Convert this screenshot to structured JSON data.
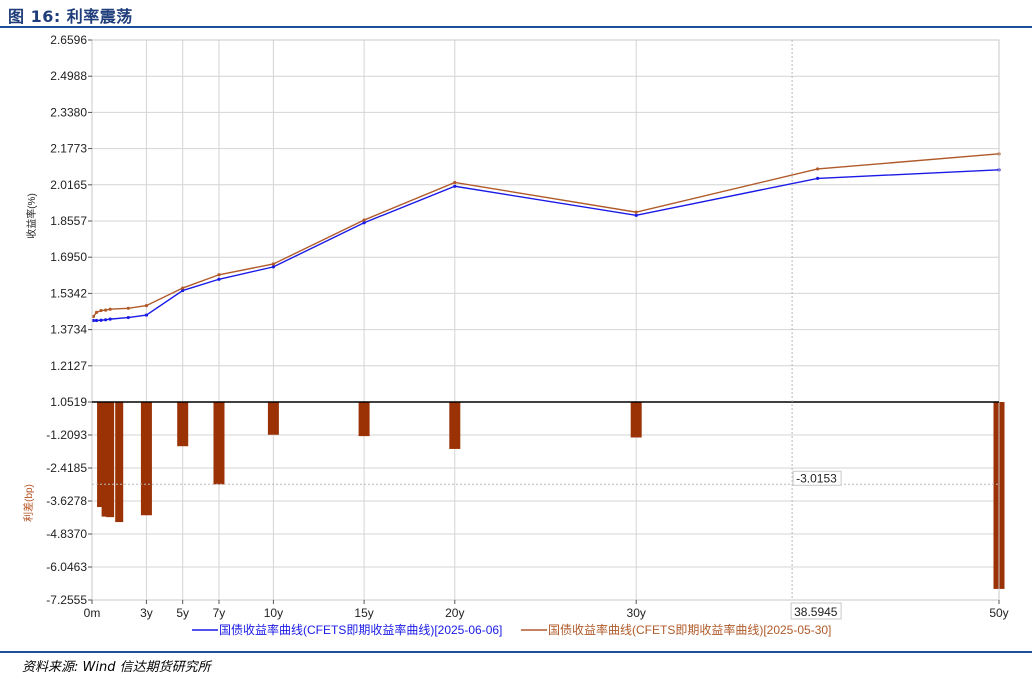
{
  "figure_title": "图 16:  利率震荡",
  "source_note": "资料来源:    Wind  信达期货研究所",
  "chart_data": [
    {
      "type": "line",
      "ylabel": "收益率(%)",
      "y_ticks": [
        "2.6596",
        "2.4988",
        "2.3380",
        "2.1773",
        "2.0165",
        "1.8557",
        "1.6950",
        "1.5342",
        "1.3734",
        "1.2127",
        "1.0519"
      ],
      "ylim": [
        1.0519,
        2.6596
      ],
      "x": [
        0.08,
        0.25,
        0.5,
        0.75,
        1,
        2,
        3,
        5,
        7,
        10,
        15,
        20,
        30,
        40,
        50
      ],
      "series": [
        {
          "name": "国债收益率曲线(CFETS即期收益率曲线)[2025-06-06]",
          "color": "#1a1ae6",
          "values": [
            1.414,
            1.414,
            1.415,
            1.417,
            1.42,
            1.427,
            1.438,
            1.547,
            1.597,
            1.652,
            1.848,
            2.01,
            1.881,
            2.045,
            2.083
          ]
        },
        {
          "name": "国债收益率曲线(CFETS即期收益率曲线)[2025-05-30]",
          "color": "#b05a2a",
          "values": [
            1.432,
            1.45,
            1.458,
            1.46,
            1.464,
            1.468,
            1.48,
            1.558,
            1.617,
            1.665,
            1.86,
            2.027,
            1.895,
            2.087,
            2.154
          ]
        }
      ],
      "grid": true
    },
    {
      "type": "bar",
      "ylabel": "利差(bp)",
      "y_ticks": [
        "-1.2093",
        "-2.4185",
        "-3.6278",
        "-4.8370",
        "-6.0463",
        "-7.2555"
      ],
      "ylim": [
        -7.2555,
        0
      ],
      "x": [
        0.5,
        0.75,
        1,
        1.5,
        3,
        5,
        7,
        10,
        15,
        20,
        30,
        50
      ],
      "values": [
        -3.85,
        -4.2,
        -4.22,
        -4.4,
        -4.15,
        -1.62,
        -3.02,
        -1.2,
        -1.25,
        -1.72,
        -1.3,
        -6.85
      ],
      "color": "#9b3205",
      "cursor_value": "-3.0153",
      "cursor_x_label": "38.5945"
    }
  ],
  "x_axis": {
    "ticks": [
      {
        "label": "0m",
        "value": 0
      },
      {
        "label": "3y",
        "value": 3
      },
      {
        "label": "5y",
        "value": 5
      },
      {
        "label": "7y",
        "value": 7
      },
      {
        "label": "10y",
        "value": 10
      },
      {
        "label": "15y",
        "value": 15
      },
      {
        "label": "20y",
        "value": 20
      },
      {
        "label": "30y",
        "value": 30
      },
      {
        "label": "50y",
        "value": 50
      }
    ]
  }
}
